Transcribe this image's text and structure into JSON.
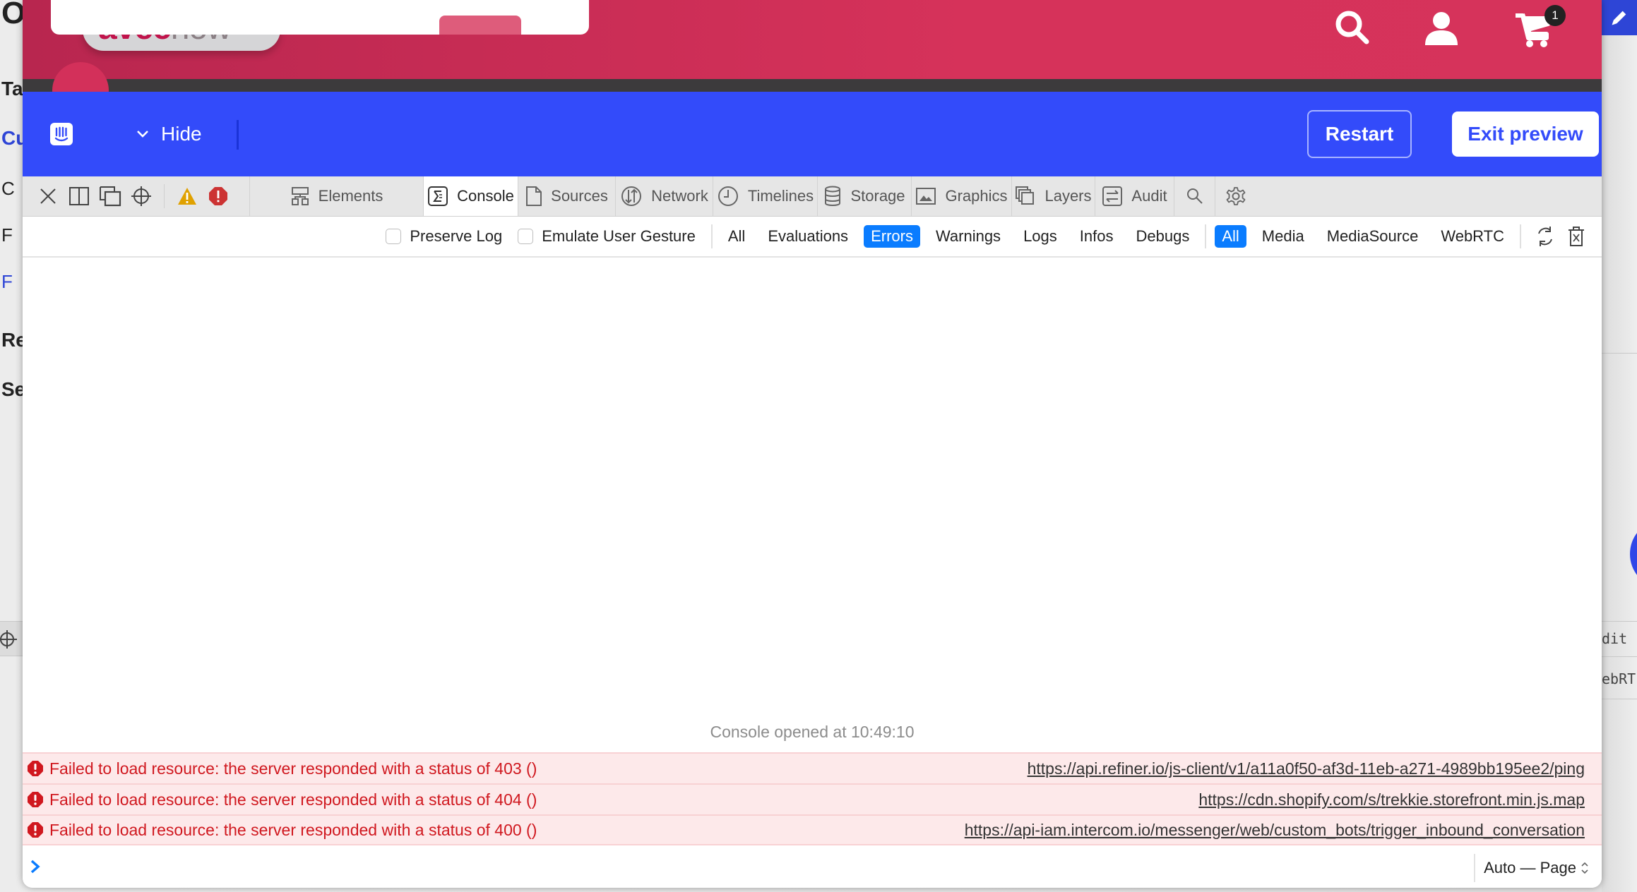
{
  "background": {
    "left_fragments": [
      "O",
      "Ta",
      "Cu",
      "C",
      "F",
      "F",
      "Re",
      "Se"
    ],
    "right_fragments": [
      "dit",
      "ebRT"
    ]
  },
  "site_header": {
    "logo_text_bold": "avec",
    "logo_text_light": "now",
    "icons": [
      "search-icon",
      "user-icon",
      "cart-icon"
    ],
    "cart_count": "1",
    "colors": {
      "header": "#d6325a",
      "strip": "#3c3a3c"
    }
  },
  "preview_bar": {
    "hide_label": "Hide",
    "restart_label": "Restart",
    "exit_label": "Exit preview",
    "color": "#334bfa"
  },
  "devtools": {
    "tabs": [
      {
        "label": "Elements",
        "icon": "elements-icon",
        "active": false
      },
      {
        "label": "Console",
        "icon": "console-icon",
        "active": true
      },
      {
        "label": "Sources",
        "icon": "sources-icon",
        "active": false
      },
      {
        "label": "Network",
        "icon": "network-icon",
        "active": false
      },
      {
        "label": "Timelines",
        "icon": "timelines-icon",
        "active": false
      },
      {
        "label": "Storage",
        "icon": "storage-icon",
        "active": false
      },
      {
        "label": "Graphics",
        "icon": "graphics-icon",
        "active": false
      },
      {
        "label": "Layers",
        "icon": "layers-icon",
        "active": false
      },
      {
        "label": "Audit",
        "icon": "audit-icon",
        "active": false
      }
    ],
    "filters": {
      "preserve_log": "Preserve Log",
      "emulate_gesture": "Emulate User Gesture",
      "levels": [
        "All",
        "Evaluations",
        "Errors",
        "Warnings",
        "Logs",
        "Infos",
        "Debugs"
      ],
      "selected_level": "Errors",
      "sources": [
        "All",
        "Media",
        "MediaSource",
        "WebRTC"
      ],
      "selected_source": "All"
    },
    "console": {
      "opened_text": "Console opened at 10:49:10",
      "messages": [
        {
          "text": "Failed to load resource: the server responded with a status of 403 ()",
          "url": "https://api.refiner.io/js-client/v1/a11a0f50-af3d-11eb-a271-4989bb195ee2/ping"
        },
        {
          "text": "Failed to load resource: the server responded with a status of 404 ()",
          "url": "https://cdn.shopify.com/s/trekkie.storefront.min.js.map"
        },
        {
          "text": "Failed to load resource: the server responded with a status of 400 ()",
          "url": "https://api-iam.intercom.io/messenger/web/custom_bots/trigger_inbound_conversation"
        }
      ],
      "execution_context": "Auto — Page"
    },
    "colors": {
      "error_text": "#d0181f",
      "error_bg": "#fde9ea",
      "selected_filter": "#0a7cff",
      "warning": "#e0a100",
      "error_icon": "#cc3333"
    }
  }
}
